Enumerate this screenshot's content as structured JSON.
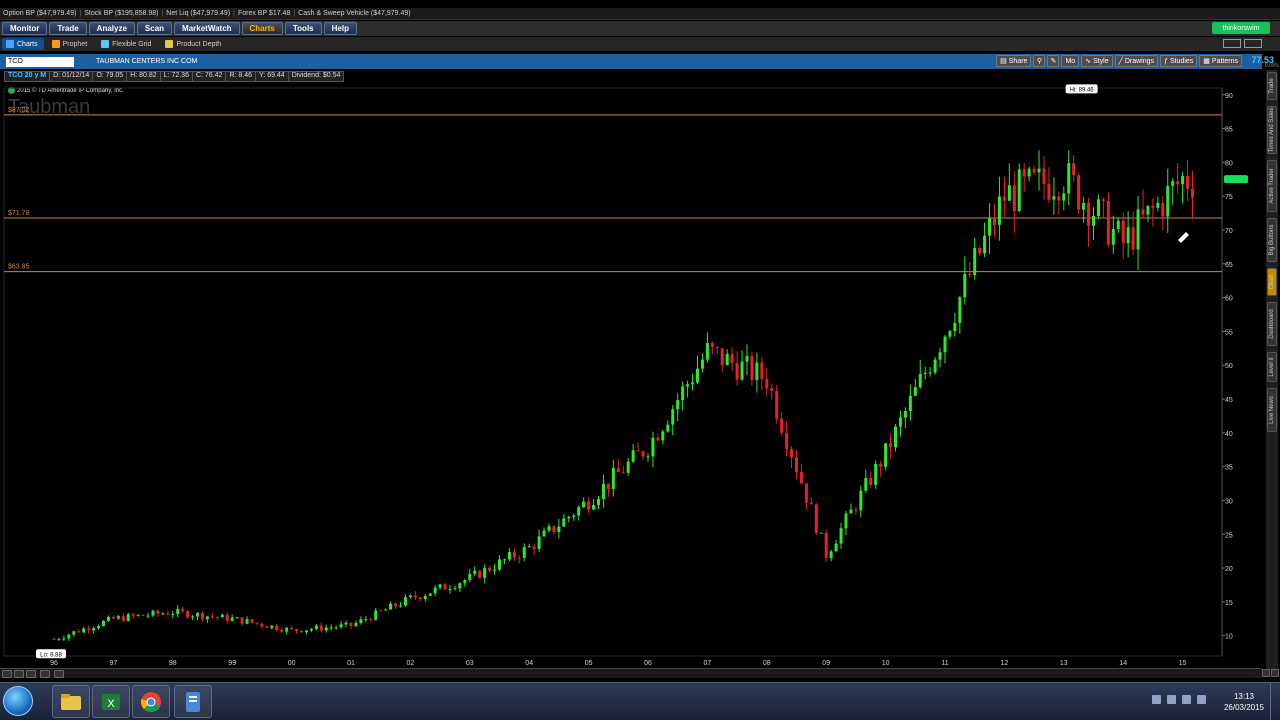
{
  "account_bar": {
    "items": [
      "Option BP  ($47,979.49)",
      "Stock BP  ($195,858.98)",
      "Net Liq  ($47,979.49)",
      "Forex BP  $17.48",
      "Cash & Sweep Vehicle  ($47,979.49)"
    ]
  },
  "main_menu": {
    "tabs": [
      "Monitor",
      "Trade",
      "Analyze",
      "Scan",
      "MarketWatch",
      "Charts",
      "Tools",
      "Help"
    ],
    "active": "Charts",
    "brand": "thinkorswim"
  },
  "sub_menu": {
    "tabs": [
      "Charts",
      "Prophet",
      "Flexible Grid",
      "Product Depth"
    ],
    "active": "Charts"
  },
  "chart_toolbar": {
    "symbol": "TCO",
    "company": "TAUBMAN CENTERS INC COM",
    "buttons": [
      "Share",
      "Style",
      "Drawings",
      "Studies",
      "Patterns"
    ],
    "mo_label": "Mo",
    "last_price": "77.53",
    "pct": "0.00%"
  },
  "info_bar": {
    "symbol": "TCO 20 y M",
    "date": "D: 01/12/14",
    "open": "O: 79.05",
    "high": "H: 80.82",
    "low": "L: 72.36",
    "close": "C: 76.42",
    "range": "R: 8.46",
    "y": "Y: 69.44",
    "dividend": "Dividend: $0.54"
  },
  "copyright": "2015 © TD Ameritrade IP Company, Inc.",
  "watermark": "Taubman",
  "right_sidebar_tabs": [
    "Trade",
    "Times And Sales",
    "Active Trader",
    "Big Buttons",
    "Chart",
    "Dashboard",
    "Level II",
    "Live News"
  ],
  "right_sidebar_active": "Chart",
  "taskbar": {
    "time": "13:13",
    "date": "26/03/2015"
  },
  "colors": {
    "up": "#2ee82e",
    "down": "#e8202a",
    "level_line": "#c8864a",
    "toolbar_blue": "#1d5fa3",
    "price_badge": "#17e05a"
  },
  "chart_data": {
    "type": "candlestick",
    "interval": "monthly",
    "symbol": "TCO",
    "x_tick_labels": [
      "96",
      "97",
      "98",
      "99",
      "00",
      "01",
      "02",
      "03",
      "04",
      "05",
      "06",
      "07",
      "08",
      "09",
      "10",
      "11",
      "12",
      "13",
      "14",
      "15"
    ],
    "y_ticks": [
      10,
      15,
      20,
      25,
      30,
      35,
      40,
      45,
      50,
      55,
      60,
      65,
      70,
      75,
      80,
      85,
      90
    ],
    "ylim": [
      7,
      91
    ],
    "horizontal_levels": [
      {
        "value": 87.02,
        "label": "$87.02"
      },
      {
        "value": 71.78,
        "label": "$71.78"
      },
      {
        "value": 63.85,
        "label": "$63.85"
      }
    ],
    "high_marker": {
      "label": "Hi: 89.46",
      "value": 89.46
    },
    "low_marker": {
      "label": "Lo: 8.88",
      "value": 8.88
    },
    "current_price": 77.53,
    "closes": [
      {
        "year": 1996,
        "close": 9.5
      },
      {
        "year": 1997,
        "close": 12.5
      },
      {
        "year": 1998,
        "close": 13.5
      },
      {
        "year": 1999,
        "close": 12.5
      },
      {
        "year": 2000,
        "close": 10.8
      },
      {
        "year": 2001,
        "close": 11.5
      },
      {
        "year": 2002,
        "close": 15.5
      },
      {
        "year": 2003,
        "close": 18.5
      },
      {
        "year": 2004,
        "close": 23
      },
      {
        "year": 2005,
        "close": 30
      },
      {
        "year": 2006,
        "close": 38
      },
      {
        "year": 2007,
        "close": 52
      },
      {
        "year": 2008,
        "close": 48
      },
      {
        "year": 2009,
        "close": 22
      },
      {
        "year": 2010,
        "close": 37
      },
      {
        "year": 2011,
        "close": 55
      },
      {
        "year": 2012,
        "close": 75
      },
      {
        "year": 2013,
        "close": 78
      },
      {
        "year": 2014,
        "close": 68
      },
      {
        "year": 2015,
        "close": 77.53
      }
    ]
  }
}
